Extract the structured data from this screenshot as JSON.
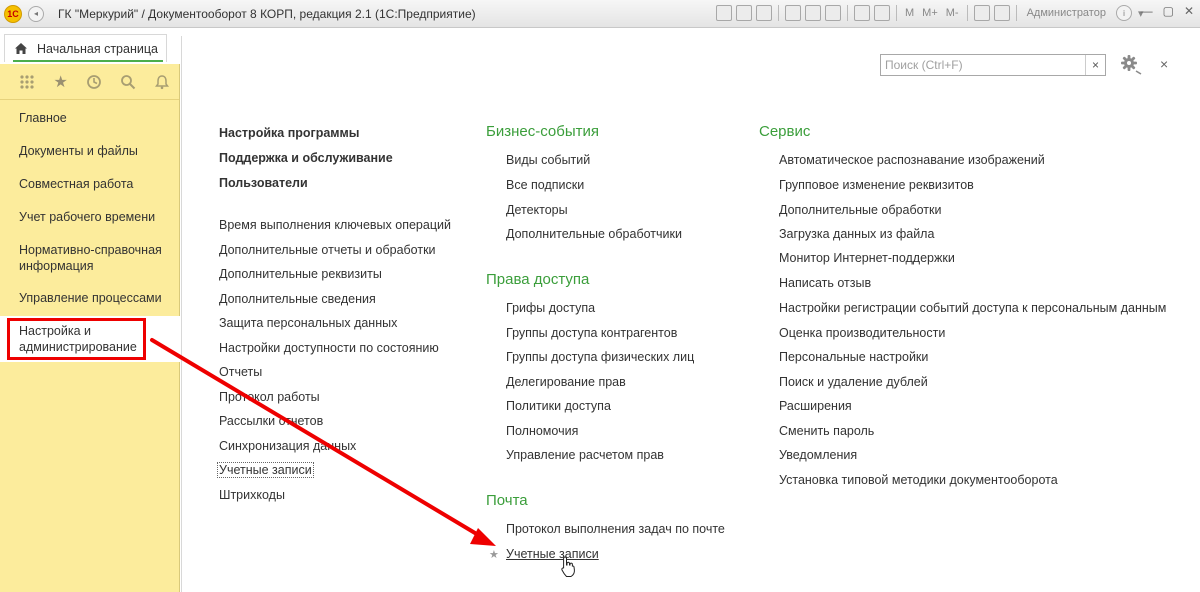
{
  "window": {
    "logo_text": "1С",
    "title": "ГК \"Меркурий\" / Документооборот 8 КОРП, редакция 2.1  (1С:Предприятие)",
    "toolbar_m_buttons": [
      "M",
      "M+",
      "M-"
    ],
    "user": "Администратор"
  },
  "tab": {
    "label": "Начальная страница"
  },
  "sidebar": {
    "items": [
      {
        "label": "Главное"
      },
      {
        "label": "Документы и файлы"
      },
      {
        "label": "Совместная работа"
      },
      {
        "label": "Учет рабочего времени"
      },
      {
        "label": "Нормативно-справочная информация"
      },
      {
        "label": "Управление процессами"
      },
      {
        "label": "Настройка и администрирование"
      }
    ]
  },
  "search": {
    "placeholder": "Поиск (Ctrl+F)",
    "clear": "×"
  },
  "close": "×",
  "col1": {
    "bold_links": [
      "Настройка программы",
      "Поддержка и обслуживание",
      "Пользователи"
    ],
    "links": [
      "Время выполнения ключевых операций",
      "Дополнительные отчеты и обработки",
      "Дополнительные реквизиты",
      "Дополнительные сведения",
      "Защита персональных данных",
      "Настройки доступности по состоянию",
      "Отчеты",
      "Протокол работы",
      "Рассылки отчетов",
      "Синхронизация данных",
      "Учетные записи",
      "Штрихкоды"
    ]
  },
  "col2": {
    "sections": [
      {
        "title": "Бизнес-события",
        "links": [
          "Виды событий",
          "Все подписки",
          "Детекторы",
          "Дополнительные обработчики"
        ]
      },
      {
        "title": "Права доступа",
        "links": [
          "Грифы доступа",
          "Группы доступа контрагентов",
          "Группы доступа физических лиц",
          "Делегирование прав",
          "Политики доступа",
          "Полномочия",
          "Управление расчетом прав"
        ]
      },
      {
        "title": "Почта",
        "links": [
          "Протокол выполнения задач по почте",
          "Учетные записи"
        ]
      }
    ]
  },
  "col3": {
    "title": "Сервис",
    "links": [
      "Автоматическое распознавание изображений",
      "Групповое изменение реквизитов",
      "Дополнительные обработки",
      "Загрузка данных из файла",
      "Монитор Интернет-поддержки",
      "Написать отзыв",
      "Настройки регистрации событий доступа к персональным данным",
      "Оценка производительности",
      "Персональные настройки",
      "Поиск и удаление дублей",
      "Расширения",
      "Сменить пароль",
      "Уведомления",
      "Установка типовой методики документооборота"
    ]
  },
  "colors": {
    "accent_green": "#3b9e3b",
    "sidebar_bg": "#fcec9c",
    "highlight_red": "#e00000"
  }
}
